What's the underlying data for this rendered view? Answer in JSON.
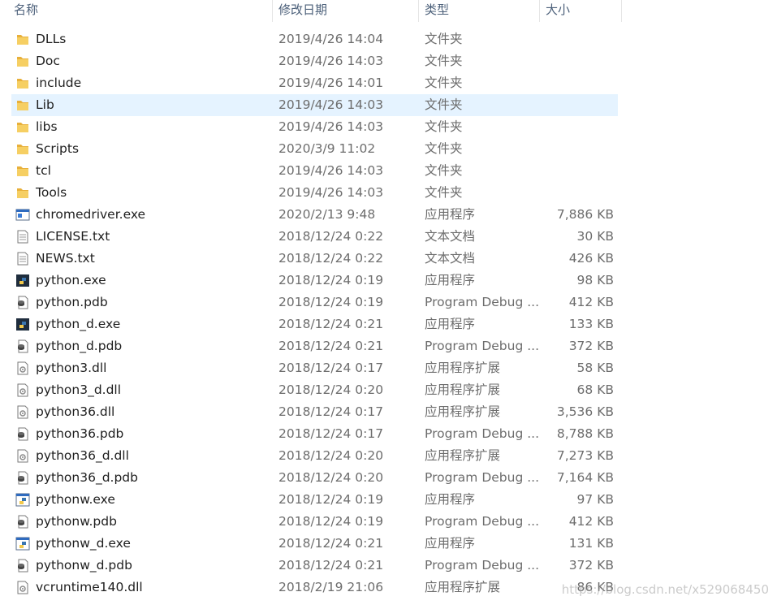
{
  "columns": {
    "name": "名称",
    "date": "修改日期",
    "type": "类型",
    "size": "大小"
  },
  "files": [
    {
      "name": "DLLs",
      "date": "2019/4/26 14:04",
      "type": "文件夹",
      "size": "",
      "icon": "folder-icon"
    },
    {
      "name": "Doc",
      "date": "2019/4/26 14:03",
      "type": "文件夹",
      "size": "",
      "icon": "folder-icon"
    },
    {
      "name": "include",
      "date": "2019/4/26 14:01",
      "type": "文件夹",
      "size": "",
      "icon": "folder-icon"
    },
    {
      "name": "Lib",
      "date": "2019/4/26 14:03",
      "type": "文件夹",
      "size": "",
      "icon": "folder-icon",
      "selected": true
    },
    {
      "name": "libs",
      "date": "2019/4/26 14:03",
      "type": "文件夹",
      "size": "",
      "icon": "folder-icon"
    },
    {
      "name": "Scripts",
      "date": "2020/3/9 11:02",
      "type": "文件夹",
      "size": "",
      "icon": "folder-icon"
    },
    {
      "name": "tcl",
      "date": "2019/4/26 14:03",
      "type": "文件夹",
      "size": "",
      "icon": "folder-icon"
    },
    {
      "name": "Tools",
      "date": "2019/4/26 14:03",
      "type": "文件夹",
      "size": "",
      "icon": "folder-icon"
    },
    {
      "name": "chromedriver.exe",
      "date": "2020/2/13 9:48",
      "type": "应用程序",
      "size": "7,886 KB",
      "icon": "application-icon"
    },
    {
      "name": "LICENSE.txt",
      "date": "2018/12/24 0:22",
      "type": "文本文档",
      "size": "30 KB",
      "icon": "text-document-icon"
    },
    {
      "name": "NEWS.txt",
      "date": "2018/12/24 0:22",
      "type": "文本文档",
      "size": "426 KB",
      "icon": "text-document-icon"
    },
    {
      "name": "python.exe",
      "date": "2018/12/24 0:19",
      "type": "应用程序",
      "size": "98 KB",
      "icon": "python-console-icon"
    },
    {
      "name": "python.pdb",
      "date": "2018/12/24 0:19",
      "type": "Program Debug ...",
      "size": "412 KB",
      "icon": "debug-database-icon"
    },
    {
      "name": "python_d.exe",
      "date": "2018/12/24 0:21",
      "type": "应用程序",
      "size": "133 KB",
      "icon": "python-console-icon"
    },
    {
      "name": "python_d.pdb",
      "date": "2018/12/24 0:21",
      "type": "Program Debug ...",
      "size": "372 KB",
      "icon": "debug-database-icon"
    },
    {
      "name": "python3.dll",
      "date": "2018/12/24 0:17",
      "type": "应用程序扩展",
      "size": "58 KB",
      "icon": "dll-icon"
    },
    {
      "name": "python3_d.dll",
      "date": "2018/12/24 0:20",
      "type": "应用程序扩展",
      "size": "68 KB",
      "icon": "dll-icon"
    },
    {
      "name": "python36.dll",
      "date": "2018/12/24 0:17",
      "type": "应用程序扩展",
      "size": "3,536 KB",
      "icon": "dll-icon"
    },
    {
      "name": "python36.pdb",
      "date": "2018/12/24 0:17",
      "type": "Program Debug ...",
      "size": "8,788 KB",
      "icon": "debug-database-icon"
    },
    {
      "name": "python36_d.dll",
      "date": "2018/12/24 0:20",
      "type": "应用程序扩展",
      "size": "7,273 KB",
      "icon": "dll-icon"
    },
    {
      "name": "python36_d.pdb",
      "date": "2018/12/24 0:20",
      "type": "Program Debug ...",
      "size": "7,164 KB",
      "icon": "debug-database-icon"
    },
    {
      "name": "pythonw.exe",
      "date": "2018/12/24 0:19",
      "type": "应用程序",
      "size": "97 KB",
      "icon": "python-window-icon"
    },
    {
      "name": "pythonw.pdb",
      "date": "2018/12/24 0:19",
      "type": "Program Debug ...",
      "size": "412 KB",
      "icon": "debug-database-icon"
    },
    {
      "name": "pythonw_d.exe",
      "date": "2018/12/24 0:21",
      "type": "应用程序",
      "size": "131 KB",
      "icon": "python-window-icon"
    },
    {
      "name": "pythonw_d.pdb",
      "date": "2018/12/24 0:21",
      "type": "Program Debug ...",
      "size": "372 KB",
      "icon": "debug-database-icon"
    },
    {
      "name": "vcruntime140.dll",
      "date": "2018/2/19 21:06",
      "type": "应用程序扩展",
      "size": "86 KB",
      "icon": "dll-icon"
    }
  ],
  "watermark": "https://blog.csdn.net/x529068450",
  "colors": {
    "selection": "#e5f3ff",
    "header_text": "#4c607a",
    "folder": "#f6c85a"
  }
}
